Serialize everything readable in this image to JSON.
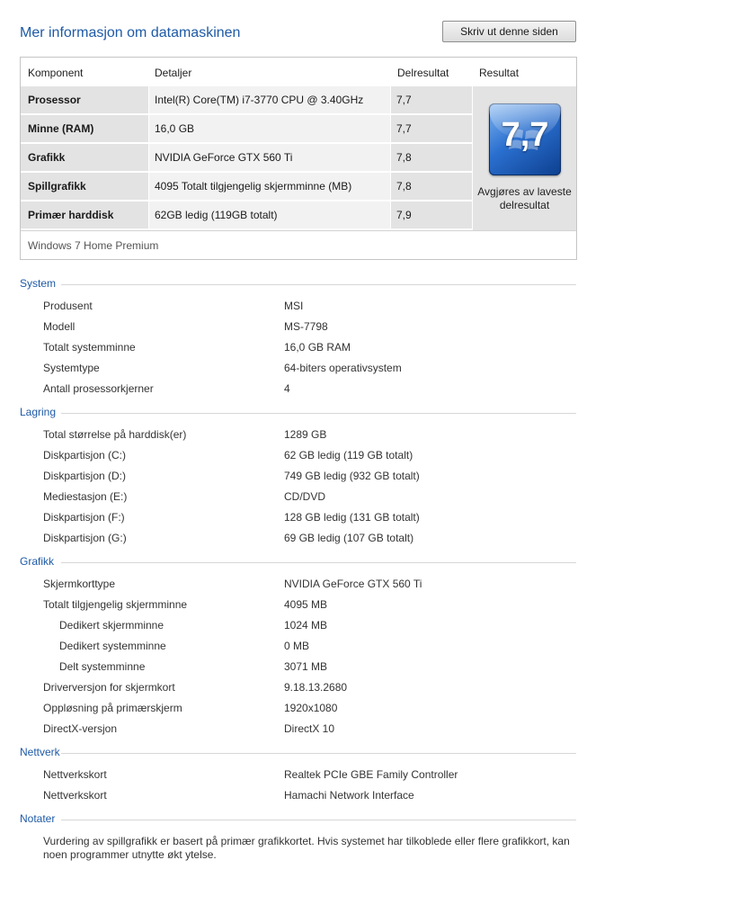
{
  "header": {
    "title": "Mer informasjon om datamaskinen",
    "print_button": "Skriv ut denne siden"
  },
  "score_table": {
    "columns": [
      "Komponent",
      "Detaljer",
      "Delresultat",
      "Resultat"
    ],
    "rows": [
      {
        "component": "Prosessor",
        "details": "Intel(R) Core(TM) i7-3770 CPU @ 3.40GHz",
        "subscore": "7,7"
      },
      {
        "component": "Minne (RAM)",
        "details": "16,0 GB",
        "subscore": "7,7"
      },
      {
        "component": "Grafikk",
        "details": "NVIDIA GeForce GTX 560 Ti",
        "subscore": "7,8"
      },
      {
        "component": "Spillgrafikk",
        "details": "4095 Totalt tilgjengelig skjermminne (MB)",
        "subscore": "7,8"
      },
      {
        "component": "Primær harddisk",
        "details": "62GB ledig (119GB totalt)",
        "subscore": "7,9"
      }
    ],
    "base_score": "7,7",
    "base_score_caption": "Avgjøres av laveste delresultat",
    "os_edition": "Windows 7 Home Premium"
  },
  "sections": {
    "system": {
      "title": "System",
      "items": [
        {
          "label": "Produsent",
          "value": "MSI"
        },
        {
          "label": "Modell",
          "value": "MS-7798"
        },
        {
          "label": "Totalt systemminne",
          "value": "16,0 GB RAM"
        },
        {
          "label": "Systemtype",
          "value": "64-biters operativsystem"
        },
        {
          "label": "Antall prosessorkjerner",
          "value": "4"
        }
      ]
    },
    "storage": {
      "title": "Lagring",
      "items": [
        {
          "label": "Total størrelse på harddisk(er)",
          "value": "1289 GB"
        },
        {
          "label": "Diskpartisjon (C:)",
          "value": "62 GB ledig (119 GB totalt)"
        },
        {
          "label": "Diskpartisjon (D:)",
          "value": "749 GB ledig (932 GB totalt)"
        },
        {
          "label": "Mediestasjon (E:)",
          "value": "CD/DVD"
        },
        {
          "label": "Diskpartisjon (F:)",
          "value": "128 GB ledig (131 GB totalt)"
        },
        {
          "label": "Diskpartisjon (G:)",
          "value": "69 GB ledig (107 GB totalt)"
        }
      ]
    },
    "graphics": {
      "title": "Grafikk",
      "items": [
        {
          "label": "Skjermkorttype",
          "value": "NVIDIA GeForce GTX 560 Ti"
        },
        {
          "label": "Totalt tilgjengelig skjermminne",
          "value": "4095 MB"
        },
        {
          "label": "Dedikert skjermminne",
          "value": "1024 MB"
        },
        {
          "label": "Dedikert systemminne",
          "value": "0 MB"
        },
        {
          "label": "Delt systemminne",
          "value": "3071 MB"
        },
        {
          "label": "Driverversjon for skjermkort",
          "value": "9.18.13.2680"
        },
        {
          "label": "Oppløsning på primærskjerm",
          "value": "1920x1080"
        },
        {
          "label": "DirectX-versjon",
          "value": "DirectX 10"
        }
      ]
    },
    "network": {
      "title": "Nettverk",
      "items": [
        {
          "label": "Nettverkskort",
          "value": "Realtek PCIe GBE Family Controller"
        },
        {
          "label": "Nettverkskort",
          "value": "Hamachi Network Interface"
        }
      ]
    },
    "notes": {
      "title": "Notater",
      "text": "Vurdering av spillgrafikk er basert på primær grafikkortet. Hvis systemet har tilkoblede eller flere grafikkort, kan noen programmer utnytte økt ytelse."
    }
  },
  "colors": {
    "accent": "#1e5aa6",
    "row_shade_dark": "#e3e3e3",
    "row_shade_light": "#f2f2f2"
  }
}
